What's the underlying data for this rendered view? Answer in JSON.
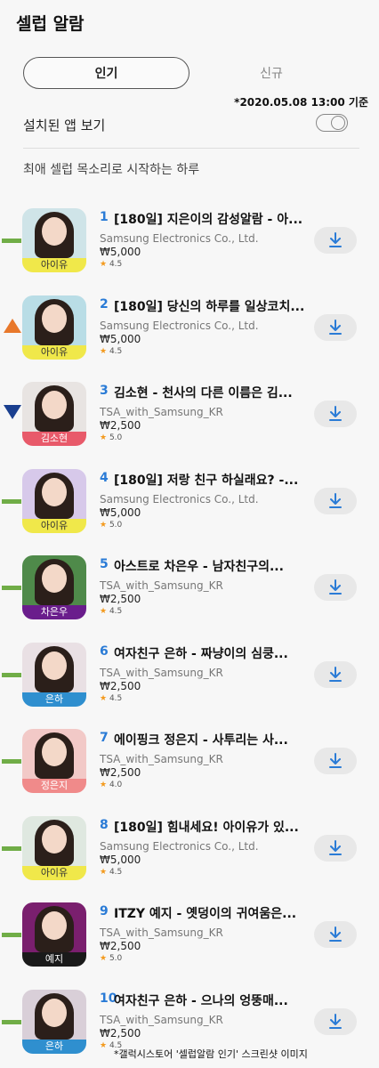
{
  "header": {
    "title": "셀럽 알람"
  },
  "tabs": [
    {
      "label": "인기",
      "active": true
    },
    {
      "label": "신규",
      "active": false
    }
  ],
  "date_note": "*2020.05.08 13:00 기준",
  "settings": {
    "installed_label": "설치된 앱 보기",
    "installed_toggle": false
  },
  "section_title": "최애 셀럽 목소리로 시작하는 하루",
  "apps": [
    {
      "rank": "1",
      "title": "[180일] 지은이의 감성알람 - 아...",
      "developer": "Samsung Electronics Co., Ltd.",
      "price": "₩5,000",
      "rating": "4.5",
      "thumb_name": "아이유",
      "trend": "same",
      "thumb_bg": "#cfe4e8",
      "name_bar": "#f0e84a",
      "name_color": "#333333"
    },
    {
      "rank": "2",
      "title": "[180일] 당신의 하루를 일상코치...",
      "developer": "Samsung Electronics Co., Ltd.",
      "price": "₩5,000",
      "rating": "4.5",
      "thumb_name": "아이유",
      "trend": "up",
      "thumb_bg": "#b9dde6",
      "name_bar": "#f0e84a",
      "name_color": "#333333"
    },
    {
      "rank": "3",
      "title": "김소현 - 천사의 다른 이름은 김...",
      "developer": "TSA_with_Samsung_KR",
      "price": "₩2,500",
      "rating": "5.0",
      "thumb_name": "김소현",
      "trend": "down",
      "thumb_bg": "#e8e4e2",
      "name_bar": "#e85a6a",
      "name_color": "#ffffff"
    },
    {
      "rank": "4",
      "title": "[180일] 저랑 친구 하실래요? -...",
      "developer": "Samsung Electronics Co., Ltd.",
      "price": "₩5,000",
      "rating": "5.0",
      "thumb_name": "아이유",
      "trend": "same",
      "thumb_bg": "#d7c9ea",
      "name_bar": "#f0e84a",
      "name_color": "#333333"
    },
    {
      "rank": "5",
      "title": "아스트로 차은우 - 남자친구의...",
      "developer": "TSA_with_Samsung_KR",
      "price": "₩2,500",
      "rating": "4.5",
      "thumb_name": "차은우",
      "trend": "same",
      "thumb_bg": "#4f8a4a",
      "name_bar": "#6a1d8c",
      "name_color": "#ffffff"
    },
    {
      "rank": "6",
      "title": "여자친구 은하 - 짜냥이의 심쿵...",
      "developer": "TSA_with_Samsung_KR",
      "price": "₩2,500",
      "rating": "4.5",
      "thumb_name": "은하",
      "trend": "same",
      "thumb_bg": "#e9e0e4",
      "name_bar": "#2f8fcf",
      "name_color": "#ffffff"
    },
    {
      "rank": "7",
      "title": "에이핑크 정은지 - 사투리는 사...",
      "developer": "TSA_with_Samsung_KR",
      "price": "₩2,500",
      "rating": "4.0",
      "thumb_name": "정은지",
      "trend": "same",
      "thumb_bg": "#f2c9c7",
      "name_bar": "#f08a8a",
      "name_color": "#ffffff"
    },
    {
      "rank": "8",
      "title": "[180일] 힘내세요! 아이유가 있...",
      "developer": "Samsung Electronics Co., Ltd.",
      "price": "₩5,000",
      "rating": "4.5",
      "thumb_name": "아이유",
      "trend": "same",
      "thumb_bg": "#dfe8e0",
      "name_bar": "#f0e84a",
      "name_color": "#333333"
    },
    {
      "rank": "9",
      "title": "ITZY 예지 - 옛덩이의 귀여움은...",
      "developer": "TSA_with_Samsung_KR",
      "price": "₩2,500",
      "rating": "5.0",
      "thumb_name": "예지",
      "trend": "same",
      "thumb_bg": "#7a1f6e",
      "name_bar": "#1a1a1a",
      "name_color": "#ffffff"
    },
    {
      "rank": "10",
      "title": "여자친구 은하 - 으나의 엉뚱매...",
      "developer": "TSA_with_Samsung_KR",
      "price": "₩2,500",
      "rating": "4.5",
      "thumb_name": "은하",
      "trend": "same",
      "thumb_bg": "#d9cfd8",
      "name_bar": "#2f8fcf",
      "name_color": "#ffffff"
    }
  ],
  "icons": {
    "download": "download-icon",
    "star": "star-icon"
  },
  "colors": {
    "rank_blue": "#2a7bd6",
    "trend_same": "#70ad47",
    "trend_up": "#e8782b",
    "trend_down": "#1a3f8f",
    "star": "#f39a1e"
  },
  "footnote": "*갤럭시스토어 '셀럽알람 인기' 스크린샷 이미지"
}
